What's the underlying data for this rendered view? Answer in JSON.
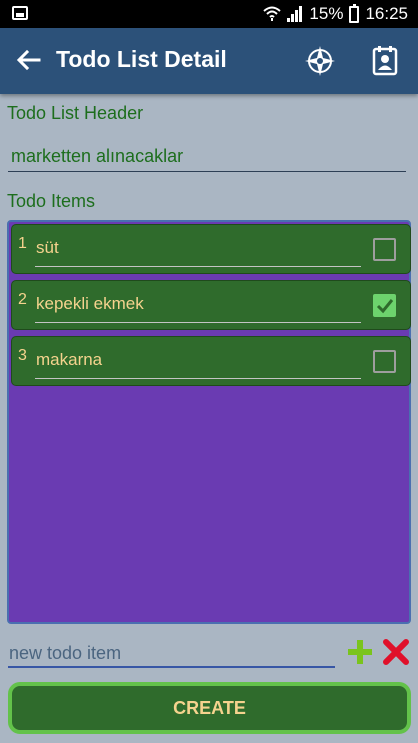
{
  "status_bar": {
    "battery": "15%",
    "time": "16:25"
  },
  "app_bar": {
    "title": "Todo List Detail",
    "back_icon": "arrow-left-icon",
    "action_icons": [
      "compass-icon",
      "contact-card-icon"
    ]
  },
  "header_section": {
    "label": "Todo List Header",
    "value": "marketten alınacaklar"
  },
  "items_section": {
    "label": "Todo Items",
    "items": [
      {
        "number": "1",
        "text": "süt",
        "checked": false
      },
      {
        "number": "2",
        "text": "kepekli ekmek",
        "checked": true
      },
      {
        "number": "3",
        "text": "makarna",
        "checked": false
      }
    ]
  },
  "new_item": {
    "placeholder": "new todo item"
  },
  "actions": {
    "create_label": "CREATE",
    "add_icon": "plus-icon",
    "clear_icon": "x-icon"
  },
  "colors": {
    "app_bar": "#2c5179",
    "background": "#aab6c3",
    "label_green": "#1d6e1d",
    "items_panel": "#6a3bb2",
    "item_bg": "#2f6b2c",
    "item_text": "#f5d38e",
    "check_green": "#6dd36d",
    "add_green": "#7ac41c",
    "clear_red": "#e0102a"
  }
}
